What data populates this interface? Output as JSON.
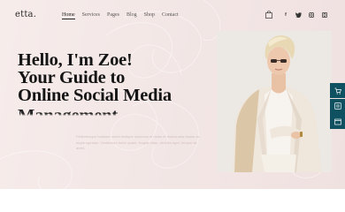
{
  "logo": "etta.",
  "nav": {
    "items": [
      "Home",
      "Services",
      "Pages",
      "Blog",
      "Shop",
      "Contact"
    ]
  },
  "social_icons": [
    "facebook-icon",
    "twitter-icon",
    "instagram-icon",
    "dribbble-icon"
  ],
  "hero": {
    "headline_lines": [
      "Hello, I'm Zoe!",
      "Your Guide to",
      "Online Social Media",
      "Management"
    ],
    "paragraph": "Pellentesque habitant morbi tristique senectus et netus et malesuada fames ac turpis egestas. Vestibulum tortor quam, feugiat vitae, ultricies eget, tempor sit amet."
  },
  "side_tools": [
    "cart-tool-icon",
    "layers-tool-icon",
    "window-tool-icon"
  ],
  "colors": {
    "accent": "#0f5160",
    "hero_bg": "#f3e7e6",
    "text_dark": "#151515"
  }
}
